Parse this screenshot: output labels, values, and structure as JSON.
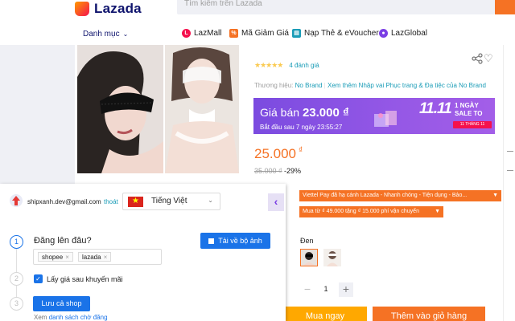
{
  "header": {
    "logo_text": "Lazada",
    "search_placeholder": "Tìm kiếm trên Lazada"
  },
  "nav": {
    "category_label": "Danh mục",
    "items": [
      {
        "label": "LazMall",
        "icon": "lazmall-icon",
        "color": "#f5114d"
      },
      {
        "label": "Mã Giảm Giá",
        "icon": "voucher-icon",
        "color": "#f57224"
      },
      {
        "label": "Nạp Thẻ & eVoucher",
        "icon": "topup-icon",
        "color": "#1a9cb7"
      },
      {
        "label": "LazGlobal",
        "icon": "lazglobal-icon",
        "color": "#7b3fe4"
      }
    ]
  },
  "product": {
    "rating_stars": "★★★★★",
    "rating_count": "4 đánh giá",
    "brand_label": "Thương hiệu:",
    "brand_name": "No Brand",
    "brand_more": "Xem thêm Nhập vai Phục trang & Đạ tiệc của No Brand",
    "promo": {
      "price_label": "Giá bán",
      "price_value": "23.000 ₫",
      "start_text": "Bắt đầu sau 7 ngày 23:55:27",
      "badge_big": "11.11",
      "badge_line1": "1 NGÀY",
      "badge_line2": "SALE TO",
      "badge_date": "11 THÁNG 11"
    },
    "price": "25.000",
    "currency": "₫",
    "old_price": "35.000 ₫",
    "discount": "-29%",
    "offers": [
      "Viettel Pay đã hạ cánh Lazada - Nhanh chóng - Tiện dụng - Bảo...",
      "Mua từ ₫ 49.000 tặng ₫ 15.000 phí vận chuyển"
    ],
    "color_label": "Đen",
    "quantity": "1",
    "buy_now": "Mua ngay",
    "add_to_cart": "Thêm vào giỏ hàng"
  },
  "extension": {
    "user_email": "shipxanh.dev@gmail.com",
    "logout": "thoát",
    "language": "Tiếng Việt",
    "step1_title": "Đăng lên đâu?",
    "download_button": "Tải về bộ ảnh",
    "tags": [
      "shopee",
      "lazada"
    ],
    "step2_label": "Lấy giá sau khuyến mãi",
    "step2_checked": true,
    "save_button": "Lưu cả shop",
    "pending_prefix": "Xem",
    "pending_link": "danh sách chờ đăng",
    "steps": [
      "1",
      "2",
      "3"
    ]
  }
}
